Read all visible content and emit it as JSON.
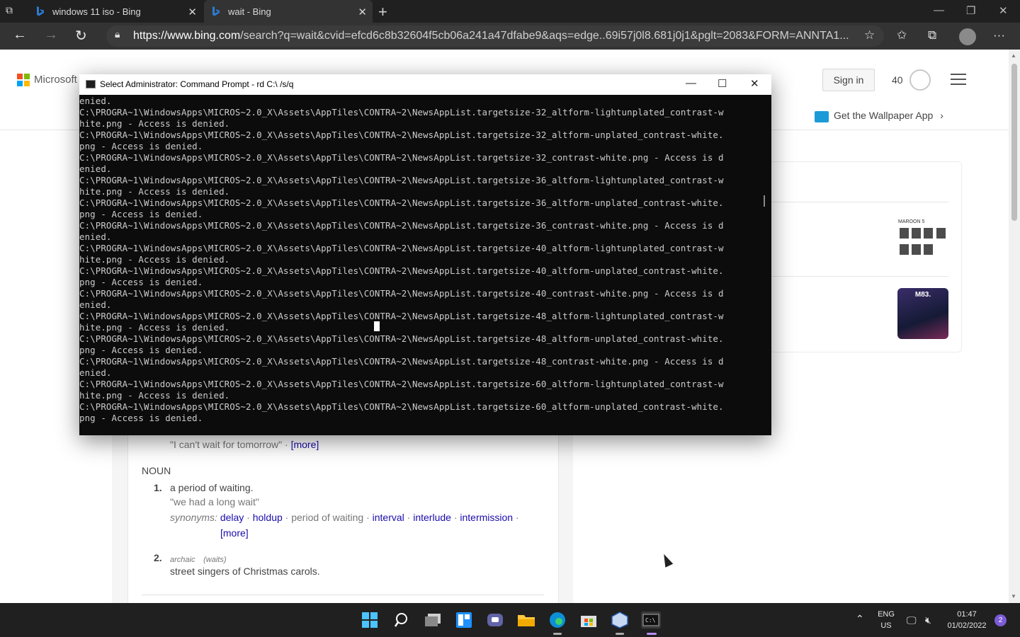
{
  "browser": {
    "tabs": [
      {
        "title": "windows 11 iso - Bing"
      },
      {
        "title": "wait - Bing"
      }
    ],
    "url_host": "https://www.bing.com",
    "url_rest": "/search?q=wait&cvid=efcd6c8b32604f5cb06a241a47dfabe9&aqs=edge..69i57j0l8.681j0j1&pglt=2083&FORM=ANNTA1..."
  },
  "bing": {
    "logo_text": "Microsoft",
    "sign_in": "Sign in",
    "points": "40",
    "wallpaper_link": "Get the Wallpaper App",
    "thumb1_label": "MAROON 5",
    "thumb2_label": "M83."
  },
  "definition": {
    "example_quote": "\"I can't wait for tomorrow\"",
    "more1": "[more]",
    "pos": "NOUN",
    "sense1_num": "1.",
    "sense1_def": "a period of waiting.",
    "sense1_example": "\"we had a long wait\"",
    "synonyms_label": "synonyms:",
    "synonyms": [
      "delay",
      "holdup",
      "period of waiting",
      "interval",
      "interlude",
      "intermission"
    ],
    "more2": "[more]",
    "sense2_num": "2.",
    "sense2_tag": "archaic",
    "sense2_form": "(waits)",
    "sense2_def": "street singers of Christmas carols."
  },
  "cmd": {
    "title": "Select Administrator: Command Prompt - rd  C:\\ /s/q",
    "lines": [
      "enied.",
      "C:\\PROGRA~1\\WindowsApps\\MICROS~2.0_X\\Assets\\AppTiles\\CONTRA~2\\NewsAppList.targetsize-32_altform-lightunplated_contrast-w",
      "hite.png - Access is denied.",
      "C:\\PROGRA~1\\WindowsApps\\MICROS~2.0_X\\Assets\\AppTiles\\CONTRA~2\\NewsAppList.targetsize-32_altform-unplated_contrast-white.",
      "png - Access is denied.",
      "C:\\PROGRA~1\\WindowsApps\\MICROS~2.0_X\\Assets\\AppTiles\\CONTRA~2\\NewsAppList.targetsize-32_contrast-white.png - Access is d",
      "enied.",
      "C:\\PROGRA~1\\WindowsApps\\MICROS~2.0_X\\Assets\\AppTiles\\CONTRA~2\\NewsAppList.targetsize-36_altform-lightunplated_contrast-w",
      "hite.png - Access is denied.",
      "C:\\PROGRA~1\\WindowsApps\\MICROS~2.0_X\\Assets\\AppTiles\\CONTRA~2\\NewsAppList.targetsize-36_altform-unplated_contrast-white.",
      "png - Access is denied.",
      "C:\\PROGRA~1\\WindowsApps\\MICROS~2.0_X\\Assets\\AppTiles\\CONTRA~2\\NewsAppList.targetsize-36_contrast-white.png - Access is d",
      "enied.",
      "C:\\PROGRA~1\\WindowsApps\\MICROS~2.0_X\\Assets\\AppTiles\\CONTRA~2\\NewsAppList.targetsize-40_altform-lightunplated_contrast-w",
      "hite.png - Access is denied.",
      "C:\\PROGRA~1\\WindowsApps\\MICROS~2.0_X\\Assets\\AppTiles\\CONTRA~2\\NewsAppList.targetsize-40_altform-unplated_contrast-white.",
      "png - Access is denied.",
      "C:\\PROGRA~1\\WindowsApps\\MICROS~2.0_X\\Assets\\AppTiles\\CONTRA~2\\NewsAppList.targetsize-40_contrast-white.png - Access is d",
      "enied.",
      "C:\\PROGRA~1\\WindowsApps\\MICROS~2.0_X\\Assets\\AppTiles\\CONTRA~2\\NewsAppList.targetsize-48_altform-lightunplated_contrast-w",
      "hite.png - Access is denied.",
      "C:\\PROGRA~1\\WindowsApps\\MICROS~2.0_X\\Assets\\AppTiles\\CONTRA~2\\NewsAppList.targetsize-48_altform-unplated_contrast-white.",
      "png - Access is denied.",
      "C:\\PROGRA~1\\WindowsApps\\MICROS~2.0_X\\Assets\\AppTiles\\CONTRA~2\\NewsAppList.targetsize-48_contrast-white.png - Access is d",
      "enied.",
      "C:\\PROGRA~1\\WindowsApps\\MICROS~2.0_X\\Assets\\AppTiles\\CONTRA~2\\NewsAppList.targetsize-60_altform-lightunplated_contrast-w",
      "hite.png - Access is denied.",
      "C:\\PROGRA~1\\WindowsApps\\MICROS~2.0_X\\Assets\\AppTiles\\CONTRA~2\\NewsAppList.targetsize-60_altform-unplated_contrast-white.",
      "png - Access is denied."
    ]
  },
  "taskbar": {
    "lang_top": "ENG",
    "lang_bottom": "US",
    "time": "01:47",
    "date": "01/02/2022",
    "notifications": "2"
  }
}
